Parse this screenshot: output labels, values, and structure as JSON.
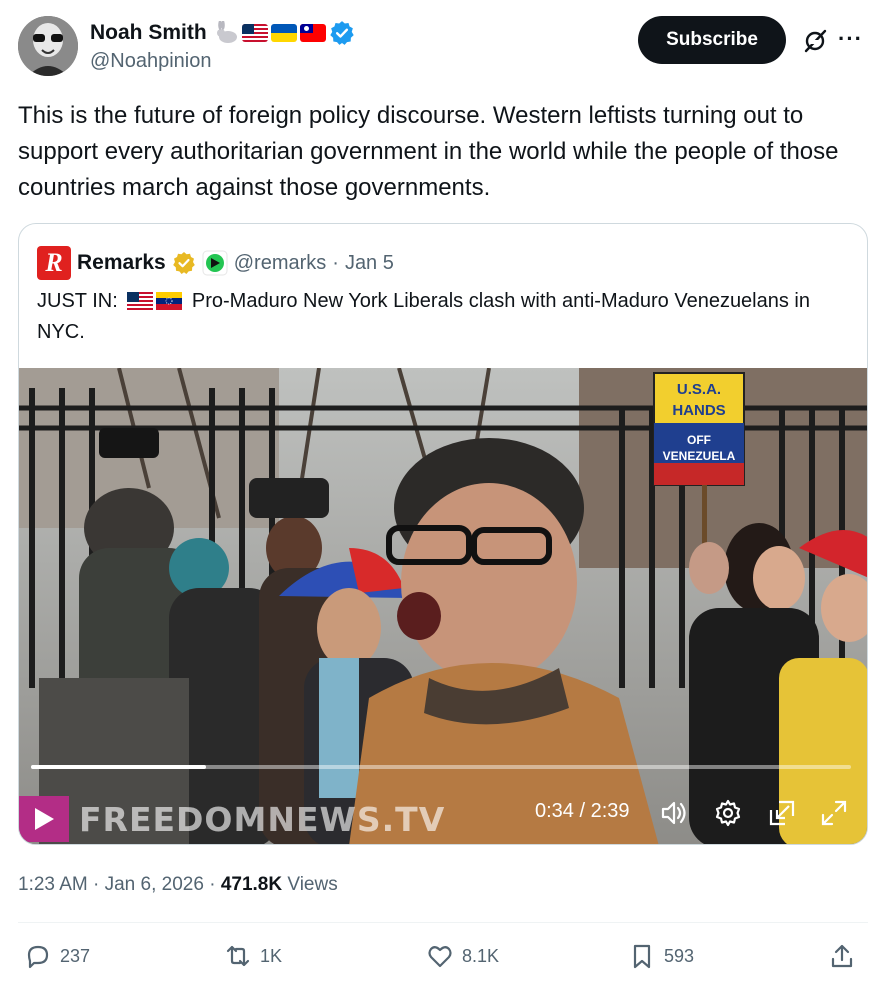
{
  "author": {
    "name": "Noah Smith",
    "handle": "@Noahpinion",
    "verified": true,
    "badges": [
      "rabbit-icon",
      "us-flag-icon",
      "ukraine-flag-icon",
      "taiwan-flag-icon"
    ]
  },
  "header": {
    "subscribe_label": "Subscribe",
    "more_label": "···"
  },
  "tweet": {
    "text": "This is the future of foreign policy discourse. Western leftists turning out to support every authoritarian government in the world while the people of those countries march against those governments."
  },
  "quote": {
    "logo_letter": "R",
    "name": "Remarks",
    "handle": "@remarks",
    "date": "Jan 5",
    "text_prefix": "JUST IN:",
    "text_body": "Pro-Maduro New York Liberals clash with anti-Maduro Venezuelans in NYC.",
    "video": {
      "watermark": "FREEDOMNEWS.TV",
      "time": "0:34 / 2:39",
      "progress": 0.214,
      "sign_lines": [
        "U.S.A.",
        "HANDS",
        "OFF",
        "VENEZUELA"
      ]
    }
  },
  "meta": {
    "time": "1:23 AM",
    "date": "Jan 6, 2026",
    "views_count": "471.8K",
    "views_label": "Views"
  },
  "actions": {
    "replies": "237",
    "reposts": "1K",
    "likes": "8.1K",
    "bookmarks": "593"
  },
  "colors": {
    "text": "#0f1419",
    "muted": "#536471",
    "verified_blue": "#1d9bf0",
    "gold_badge": "#e8b923",
    "remarks_red": "#e0211f",
    "play_purple": "#b32d86"
  }
}
